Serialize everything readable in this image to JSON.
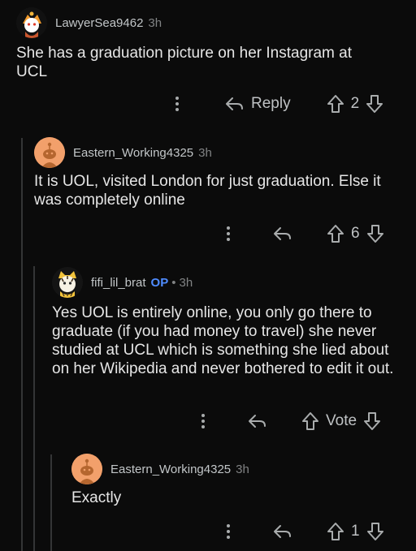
{
  "comments": [
    {
      "username": "LawyerSea9462",
      "time": "3h",
      "text": "She has a graduation picture on her Instagram at UCL",
      "reply_label": "Reply",
      "vote_count": "2"
    },
    {
      "username": "Eastern_Working4325",
      "time": "3h",
      "text": "It is UOL, visited London for just graduation. Else it was completely online",
      "vote_count": "6"
    },
    {
      "username": "fifi_lil_brat",
      "op_badge": "OP",
      "separator": "•",
      "time": "3h",
      "text": "Yes UOL is entirely online, you only go there to graduate (if you had money to travel) she never studied at UCL which is something she lied about on her Wikipedia and never bothered to edit it out.",
      "vote_count": "Vote"
    },
    {
      "username": "Eastern_Working4325",
      "time": "3h",
      "text": "Exactly",
      "vote_count": "1"
    }
  ],
  "colors": {
    "background": "#0b0b0b",
    "thread_line": "#343536",
    "op_badge": "#4f8cff",
    "avatar_orange": "#f2a06b"
  },
  "icons": [
    "more-options-icon",
    "reply-arrow-icon",
    "upvote-arrow-icon",
    "downvote-arrow-icon"
  ]
}
